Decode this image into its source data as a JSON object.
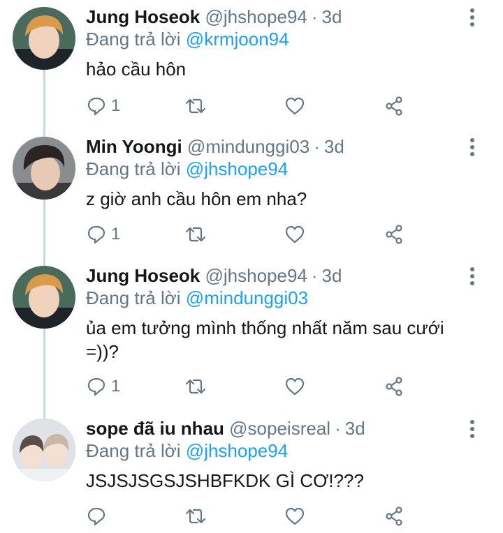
{
  "reply_prefix": "Đang trả lời",
  "tweets": [
    {
      "name": "Jung Hoseok",
      "handle": "@jhshope94",
      "time": "3d",
      "reply_to": "@krmjoon94",
      "text": "hảo cầu hôn",
      "reply_count": "1",
      "avatar": {
        "bg": "#4a6b5c",
        "hair": "#d99a4a",
        "skin": "#f1d3bd"
      }
    },
    {
      "name": "Min Yoongi",
      "handle": "@mindunggi03",
      "time": "3d",
      "reply_to": "@jhshope94",
      "text": "z giờ anh cầu hôn em nha?",
      "reply_count": "1",
      "avatar": {
        "bg": "#8a8d90",
        "hair": "#2a2424",
        "skin": "#e8c9b6"
      }
    },
    {
      "name": "Jung Hoseok",
      "handle": "@jhshope94",
      "time": "3d",
      "reply_to": "@mindunggi03",
      "text": "ủa em tưởng mình thống nhất năm sau cưới =))?",
      "reply_count": "1",
      "avatar": {
        "bg": "#4a6b5c",
        "hair": "#d99a4a",
        "skin": "#f1d3bd"
      }
    },
    {
      "name": "sope đã iu nhau",
      "handle": "@sopeisreal",
      "time": "3d",
      "reply_to": "@jhshope94",
      "text": "JSJSJSGSJSHBFKDK GÌ CƠ!???",
      "reply_count": "",
      "avatar": {
        "bg": "#dfe3e8",
        "hair": "#c9b8a6",
        "skin": "#f3e0d2"
      }
    }
  ],
  "colors": {
    "name": "#14171a",
    "secondary": "#657786",
    "link": "#1da1f2",
    "icon": "#657786"
  }
}
